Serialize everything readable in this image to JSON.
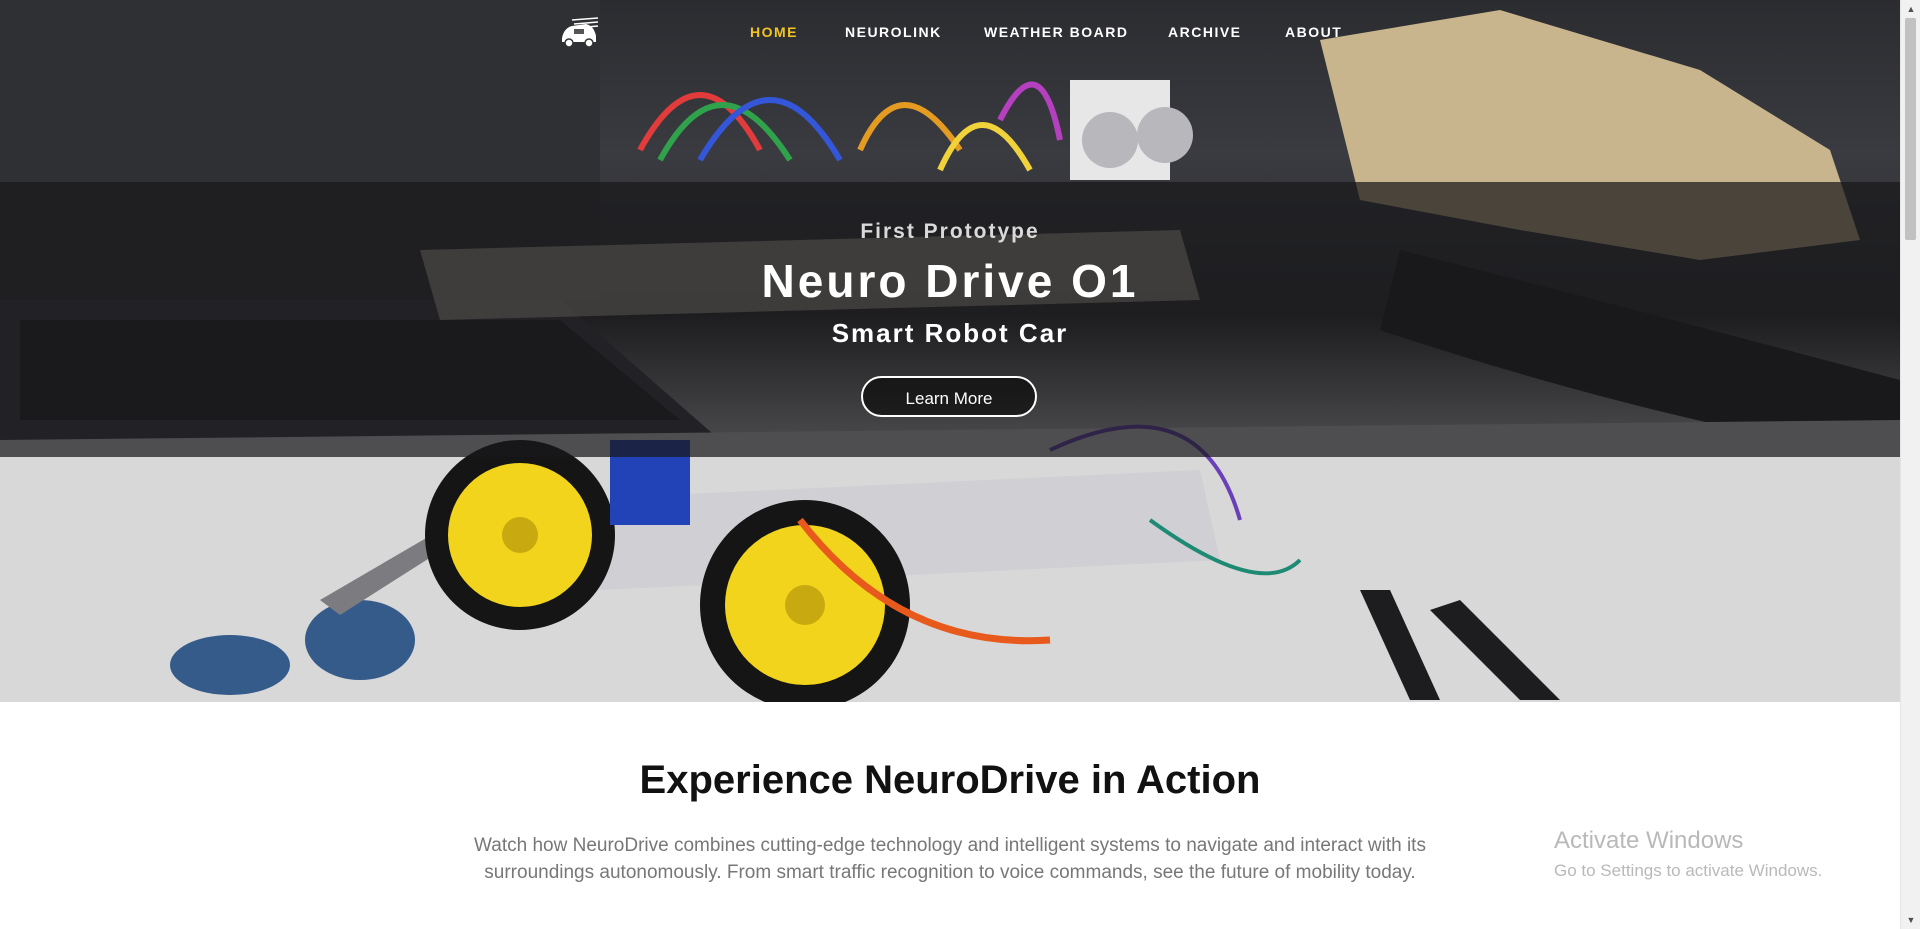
{
  "nav": {
    "items": [
      {
        "label": "HOME",
        "active": true
      },
      {
        "label": "NEUROLINK"
      },
      {
        "label": "WEATHER BOARD"
      },
      {
        "label": "ARCHIVE"
      },
      {
        "label": "ABOUT"
      }
    ],
    "active_color": "#f2c521",
    "logo_icon": "car-logo-icon"
  },
  "hero": {
    "kicker": "First Prototype",
    "title": "Neuro Drive O1",
    "subtitle": "Smart Robot Car",
    "button": "Learn More"
  },
  "section": {
    "title": "Experience NeuroDrive in Action",
    "text": "Watch how NeuroDrive combines cutting-edge technology and intelligent systems to navigate and interact with its surroundings autonomously. From smart traffic recognition to voice commands, see the future of mobility today."
  },
  "watermark": {
    "line1": "Activate Windows",
    "line2": "Go to Settings to activate Windows."
  },
  "scrollbar": {
    "up_icon": "▲",
    "down_icon": "▼"
  }
}
